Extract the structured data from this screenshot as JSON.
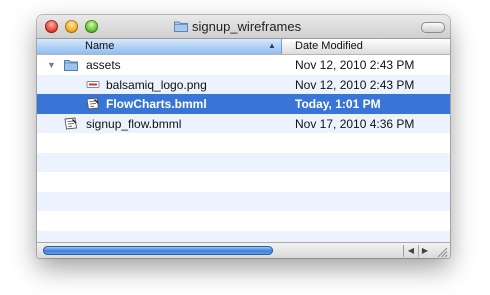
{
  "window": {
    "title": "signup_wireframes",
    "title_icon": "folder-icon"
  },
  "columns": {
    "name": "Name",
    "date": "Date Modified",
    "sort": "ascending"
  },
  "files": [
    {
      "name": "assets",
      "date": "Nov 12, 2010 2:43 PM",
      "icon": "folder-icon",
      "expanded": true,
      "level": 0,
      "selected": false
    },
    {
      "name": "balsamiq_logo.png",
      "date": "Nov 12, 2010 2:43 PM",
      "icon": "png-file-icon",
      "level": 1,
      "selected": false
    },
    {
      "name": "FlowCharts.bmml",
      "date": "Today, 1:01 PM",
      "icon": "bmml-file-icon",
      "level": 1,
      "selected": true
    },
    {
      "name": "signup_flow.bmml",
      "date": "Nov 17, 2010 4:36 PM",
      "icon": "bmml-file-icon",
      "level": 0,
      "selected": false
    }
  ],
  "colors": {
    "selection": "#3875d7",
    "alt_row": "#edf3fe",
    "folder": "#7fa9d8"
  }
}
